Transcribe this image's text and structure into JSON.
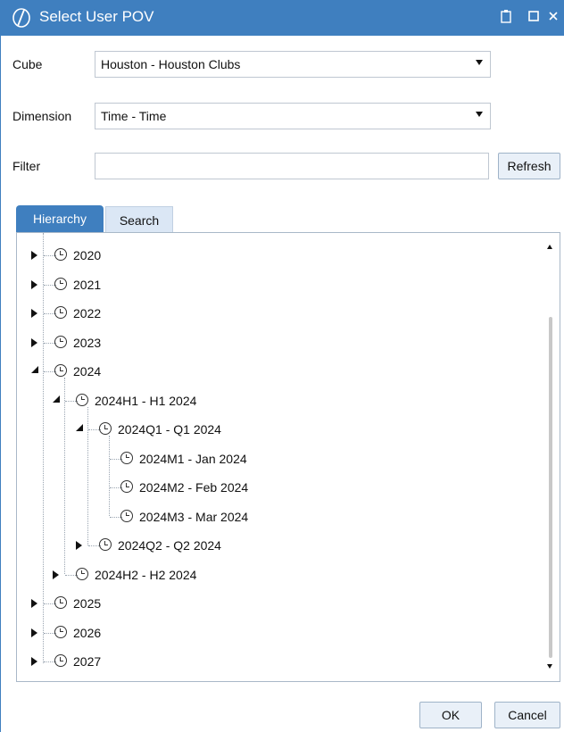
{
  "window": {
    "title": "Select User POV",
    "controls": [
      "clipboard-icon",
      "maximize-icon",
      "close-icon"
    ]
  },
  "cube": {
    "label": "Cube",
    "value": "Houston - Houston Clubs"
  },
  "dimension": {
    "label": "Dimension",
    "value": "Time - Time"
  },
  "filter": {
    "label": "Filter",
    "value": "",
    "placeholder": ""
  },
  "buttons": {
    "refresh": "Refresh",
    "ok": "OK",
    "cancel": "Cancel"
  },
  "tabs": [
    {
      "label": "Hierarchy",
      "active": true
    },
    {
      "label": "Search",
      "active": false
    }
  ],
  "tree": [
    {
      "label": "2020",
      "depth": 0,
      "expanded": false,
      "has_children": true
    },
    {
      "label": "2021",
      "depth": 0,
      "expanded": false,
      "has_children": true
    },
    {
      "label": "2022",
      "depth": 0,
      "expanded": false,
      "has_children": true
    },
    {
      "label": "2023",
      "depth": 0,
      "expanded": false,
      "has_children": true
    },
    {
      "label": "2024",
      "depth": 0,
      "expanded": true,
      "has_children": true
    },
    {
      "label": "2024H1 - H1 2024",
      "depth": 1,
      "expanded": true,
      "has_children": true
    },
    {
      "label": "2024Q1 - Q1 2024",
      "depth": 2,
      "expanded": true,
      "has_children": true
    },
    {
      "label": "2024M1 - Jan 2024",
      "depth": 3,
      "expanded": false,
      "has_children": false
    },
    {
      "label": "2024M2 - Feb 2024",
      "depth": 3,
      "expanded": false,
      "has_children": false
    },
    {
      "label": "2024M3 - Mar 2024",
      "depth": 3,
      "expanded": false,
      "has_children": false
    },
    {
      "label": "2024Q2 - Q2 2024",
      "depth": 2,
      "expanded": false,
      "has_children": true
    },
    {
      "label": "2024H2 - H2 2024",
      "depth": 1,
      "expanded": false,
      "has_children": true
    },
    {
      "label": "2025",
      "depth": 0,
      "expanded": false,
      "has_children": true
    },
    {
      "label": "2026",
      "depth": 0,
      "expanded": false,
      "has_children": true
    },
    {
      "label": "2027",
      "depth": 0,
      "expanded": false,
      "has_children": true
    }
  ],
  "colors": {
    "accent": "#3f7fbf",
    "tab_inactive": "#dbe7f5",
    "button_bg": "#e9f0f8"
  }
}
